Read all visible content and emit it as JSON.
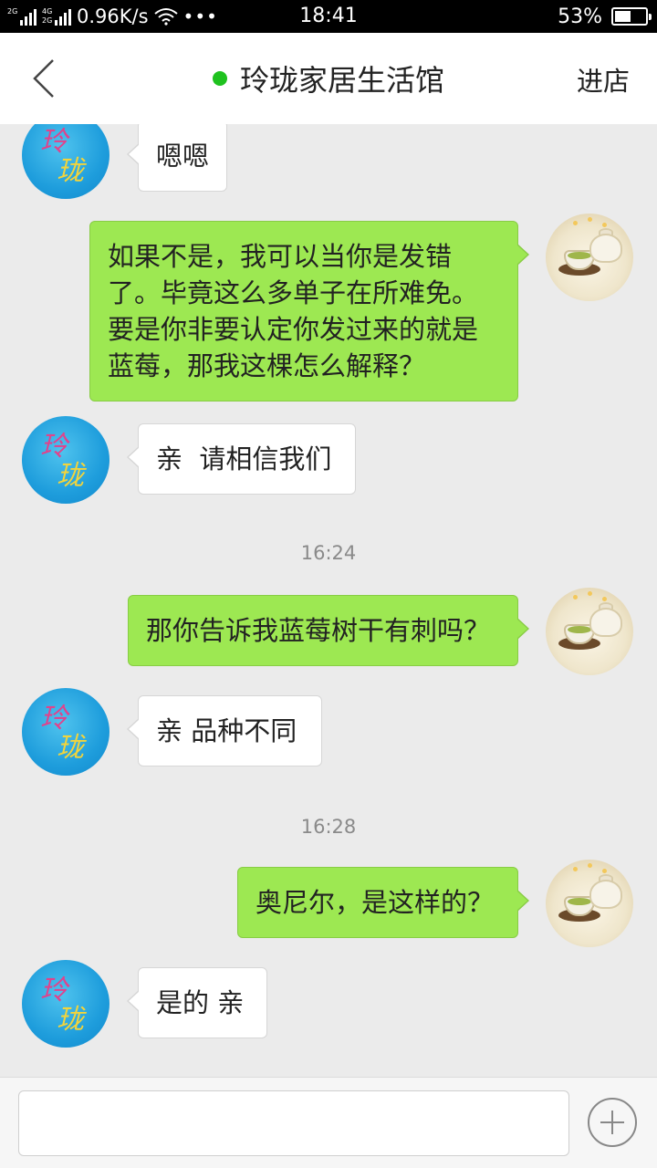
{
  "status_bar": {
    "network_top": "2G",
    "network_mid": "4G",
    "network_bottom": "2G",
    "speed": "0.96K/s",
    "more": "•••",
    "time": "18:41",
    "battery": "53%",
    "battery_level": 0.53
  },
  "header": {
    "title": "玲珑家居生活馆",
    "enter_shop": "进店",
    "status_color": "#1fc21f"
  },
  "shop_avatar_text": [
    "玲",
    "珑"
  ],
  "messages": [
    {
      "from": "shop",
      "text": "嗯嗯"
    },
    {
      "from": "user",
      "text": "如果不是，我可以当你是发错了。毕竟这么多单子在所难免。要是你非要认定你发过来的就是蓝莓，那我这棵怎么解释？"
    },
    {
      "from": "shop",
      "text": "亲  请相信我们"
    },
    {
      "time": "16:24"
    },
    {
      "from": "user",
      "text": "那你告诉我蓝莓树干有刺吗？"
    },
    {
      "from": "shop",
      "text": "亲 品种不同"
    },
    {
      "time": "16:28"
    },
    {
      "from": "user",
      "text": "奥尼尔，是这样的？"
    },
    {
      "from": "shop",
      "text": "是的 亲"
    }
  ],
  "input": {
    "value": "",
    "placeholder": ""
  },
  "colors": {
    "user_bubble": "#9de852",
    "shop_bubble": "#ffffff",
    "background": "#ebebeb"
  }
}
